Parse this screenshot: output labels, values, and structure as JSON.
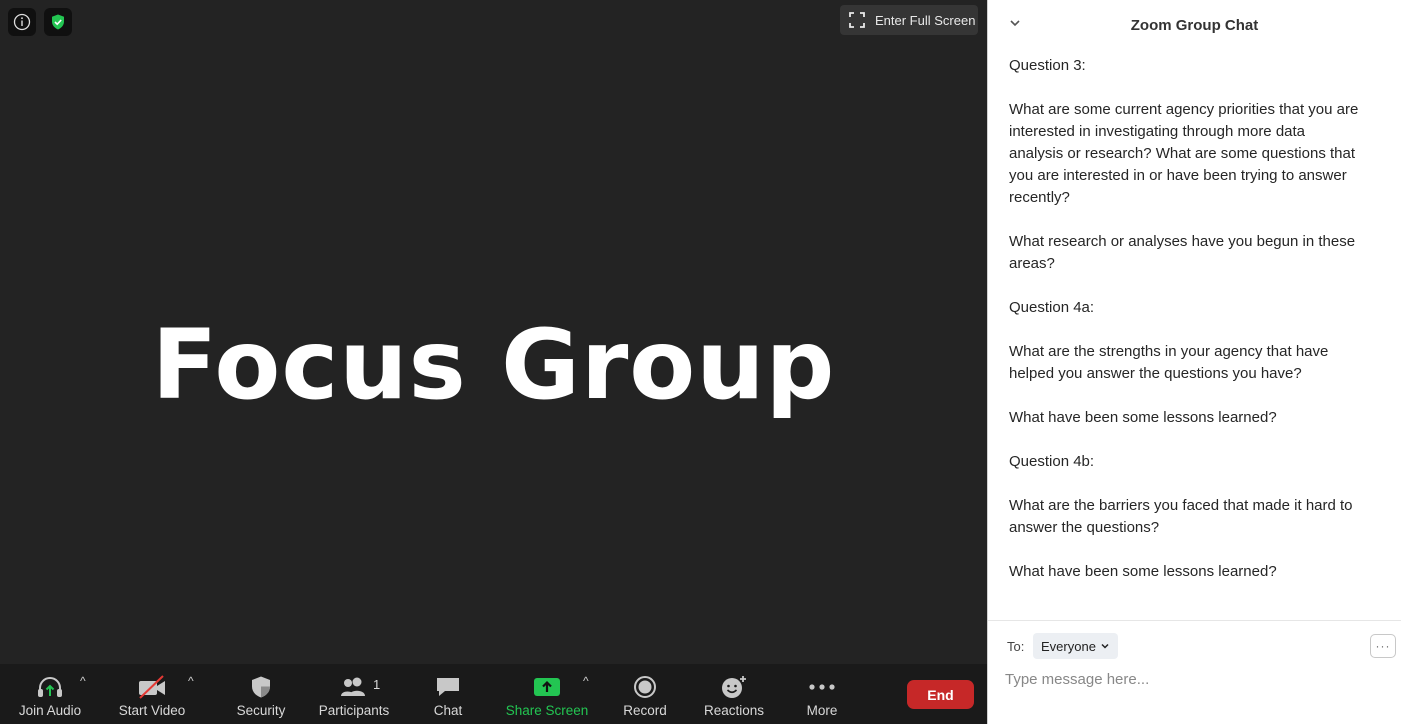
{
  "video": {
    "title": "Focus Group",
    "fullscreen_label": "Enter Full Screen"
  },
  "toolbar": {
    "join_audio": "Join Audio",
    "start_video": "Start Video",
    "security": "Security",
    "participants": "Participants",
    "participants_count": "1",
    "chat": "Chat",
    "share_screen": "Share Screen",
    "record": "Record",
    "reactions": "Reactions",
    "more": "More",
    "end": "End"
  },
  "colors": {
    "share_green": "#23c552",
    "end_red": "#c62828"
  },
  "chat": {
    "title": "Zoom Group Chat",
    "messages": [
      "Question 3:",
      "What are some current agency priorities that you are interested in investigating through more data analysis or research? What are some questions that you are interested in or have been trying to answer recently?",
      "What research or analyses have you begun in these areas?",
      "Question 4a:",
      "What are the strengths in your agency that have helped you answer the questions you have?",
      "What have been some lessons learned?",
      "Question 4b:",
      "What are the barriers you faced that made it hard to answer the questions?",
      "What have been some lessons learned?"
    ],
    "to_label": "To:",
    "recipient": "Everyone",
    "placeholder": "Type message here..."
  }
}
